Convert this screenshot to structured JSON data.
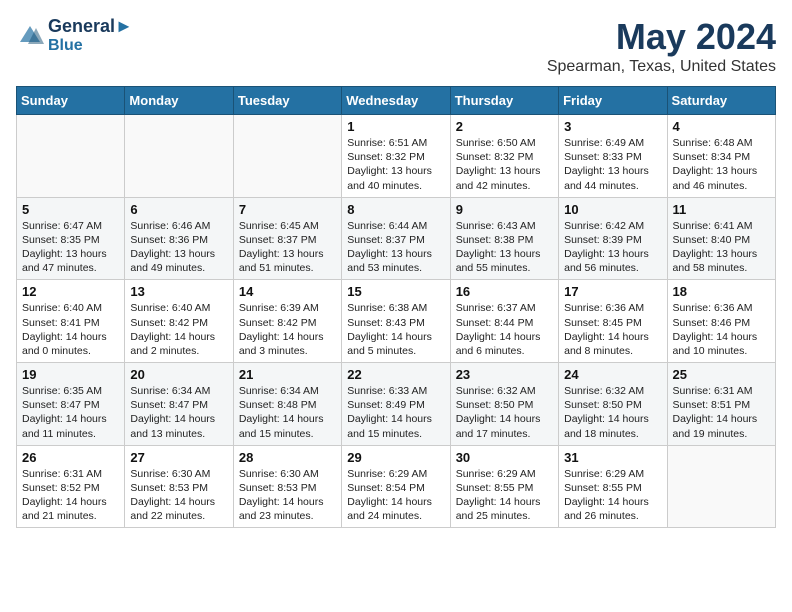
{
  "header": {
    "logo_line1": "General",
    "logo_line2": "Blue",
    "month": "May 2024",
    "location": "Spearman, Texas, United States"
  },
  "weekdays": [
    "Sunday",
    "Monday",
    "Tuesday",
    "Wednesday",
    "Thursday",
    "Friday",
    "Saturday"
  ],
  "weeks": [
    [
      {
        "day": "",
        "sunrise": "",
        "sunset": "",
        "daylight": ""
      },
      {
        "day": "",
        "sunrise": "",
        "sunset": "",
        "daylight": ""
      },
      {
        "day": "",
        "sunrise": "",
        "sunset": "",
        "daylight": ""
      },
      {
        "day": "1",
        "sunrise": "Sunrise: 6:51 AM",
        "sunset": "Sunset: 8:32 PM",
        "daylight": "Daylight: 13 hours and 40 minutes."
      },
      {
        "day": "2",
        "sunrise": "Sunrise: 6:50 AM",
        "sunset": "Sunset: 8:32 PM",
        "daylight": "Daylight: 13 hours and 42 minutes."
      },
      {
        "day": "3",
        "sunrise": "Sunrise: 6:49 AM",
        "sunset": "Sunset: 8:33 PM",
        "daylight": "Daylight: 13 hours and 44 minutes."
      },
      {
        "day": "4",
        "sunrise": "Sunrise: 6:48 AM",
        "sunset": "Sunset: 8:34 PM",
        "daylight": "Daylight: 13 hours and 46 minutes."
      }
    ],
    [
      {
        "day": "5",
        "sunrise": "Sunrise: 6:47 AM",
        "sunset": "Sunset: 8:35 PM",
        "daylight": "Daylight: 13 hours and 47 minutes."
      },
      {
        "day": "6",
        "sunrise": "Sunrise: 6:46 AM",
        "sunset": "Sunset: 8:36 PM",
        "daylight": "Daylight: 13 hours and 49 minutes."
      },
      {
        "day": "7",
        "sunrise": "Sunrise: 6:45 AM",
        "sunset": "Sunset: 8:37 PM",
        "daylight": "Daylight: 13 hours and 51 minutes."
      },
      {
        "day": "8",
        "sunrise": "Sunrise: 6:44 AM",
        "sunset": "Sunset: 8:37 PM",
        "daylight": "Daylight: 13 hours and 53 minutes."
      },
      {
        "day": "9",
        "sunrise": "Sunrise: 6:43 AM",
        "sunset": "Sunset: 8:38 PM",
        "daylight": "Daylight: 13 hours and 55 minutes."
      },
      {
        "day": "10",
        "sunrise": "Sunrise: 6:42 AM",
        "sunset": "Sunset: 8:39 PM",
        "daylight": "Daylight: 13 hours and 56 minutes."
      },
      {
        "day": "11",
        "sunrise": "Sunrise: 6:41 AM",
        "sunset": "Sunset: 8:40 PM",
        "daylight": "Daylight: 13 hours and 58 minutes."
      }
    ],
    [
      {
        "day": "12",
        "sunrise": "Sunrise: 6:40 AM",
        "sunset": "Sunset: 8:41 PM",
        "daylight": "Daylight: 14 hours and 0 minutes."
      },
      {
        "day": "13",
        "sunrise": "Sunrise: 6:40 AM",
        "sunset": "Sunset: 8:42 PM",
        "daylight": "Daylight: 14 hours and 2 minutes."
      },
      {
        "day": "14",
        "sunrise": "Sunrise: 6:39 AM",
        "sunset": "Sunset: 8:42 PM",
        "daylight": "Daylight: 14 hours and 3 minutes."
      },
      {
        "day": "15",
        "sunrise": "Sunrise: 6:38 AM",
        "sunset": "Sunset: 8:43 PM",
        "daylight": "Daylight: 14 hours and 5 minutes."
      },
      {
        "day": "16",
        "sunrise": "Sunrise: 6:37 AM",
        "sunset": "Sunset: 8:44 PM",
        "daylight": "Daylight: 14 hours and 6 minutes."
      },
      {
        "day": "17",
        "sunrise": "Sunrise: 6:36 AM",
        "sunset": "Sunset: 8:45 PM",
        "daylight": "Daylight: 14 hours and 8 minutes."
      },
      {
        "day": "18",
        "sunrise": "Sunrise: 6:36 AM",
        "sunset": "Sunset: 8:46 PM",
        "daylight": "Daylight: 14 hours and 10 minutes."
      }
    ],
    [
      {
        "day": "19",
        "sunrise": "Sunrise: 6:35 AM",
        "sunset": "Sunset: 8:47 PM",
        "daylight": "Daylight: 14 hours and 11 minutes."
      },
      {
        "day": "20",
        "sunrise": "Sunrise: 6:34 AM",
        "sunset": "Sunset: 8:47 PM",
        "daylight": "Daylight: 14 hours and 13 minutes."
      },
      {
        "day": "21",
        "sunrise": "Sunrise: 6:34 AM",
        "sunset": "Sunset: 8:48 PM",
        "daylight": "Daylight: 14 hours and 15 minutes."
      },
      {
        "day": "22",
        "sunrise": "Sunrise: 6:33 AM",
        "sunset": "Sunset: 8:49 PM",
        "daylight": "Daylight: 14 hours and 15 minutes."
      },
      {
        "day": "23",
        "sunrise": "Sunrise: 6:32 AM",
        "sunset": "Sunset: 8:50 PM",
        "daylight": "Daylight: 14 hours and 17 minutes."
      },
      {
        "day": "24",
        "sunrise": "Sunrise: 6:32 AM",
        "sunset": "Sunset: 8:50 PM",
        "daylight": "Daylight: 14 hours and 18 minutes."
      },
      {
        "day": "25",
        "sunrise": "Sunrise: 6:31 AM",
        "sunset": "Sunset: 8:51 PM",
        "daylight": "Daylight: 14 hours and 19 minutes."
      }
    ],
    [
      {
        "day": "26",
        "sunrise": "Sunrise: 6:31 AM",
        "sunset": "Sunset: 8:52 PM",
        "daylight": "Daylight: 14 hours and 21 minutes."
      },
      {
        "day": "27",
        "sunrise": "Sunrise: 6:30 AM",
        "sunset": "Sunset: 8:53 PM",
        "daylight": "Daylight: 14 hours and 22 minutes."
      },
      {
        "day": "28",
        "sunrise": "Sunrise: 6:30 AM",
        "sunset": "Sunset: 8:53 PM",
        "daylight": "Daylight: 14 hours and 23 minutes."
      },
      {
        "day": "29",
        "sunrise": "Sunrise: 6:29 AM",
        "sunset": "Sunset: 8:54 PM",
        "daylight": "Daylight: 14 hours and 24 minutes."
      },
      {
        "day": "30",
        "sunrise": "Sunrise: 6:29 AM",
        "sunset": "Sunset: 8:55 PM",
        "daylight": "Daylight: 14 hours and 25 minutes."
      },
      {
        "day": "31",
        "sunrise": "Sunrise: 6:29 AM",
        "sunset": "Sunset: 8:55 PM",
        "daylight": "Daylight: 14 hours and 26 minutes."
      },
      {
        "day": "",
        "sunrise": "",
        "sunset": "",
        "daylight": ""
      }
    ]
  ]
}
